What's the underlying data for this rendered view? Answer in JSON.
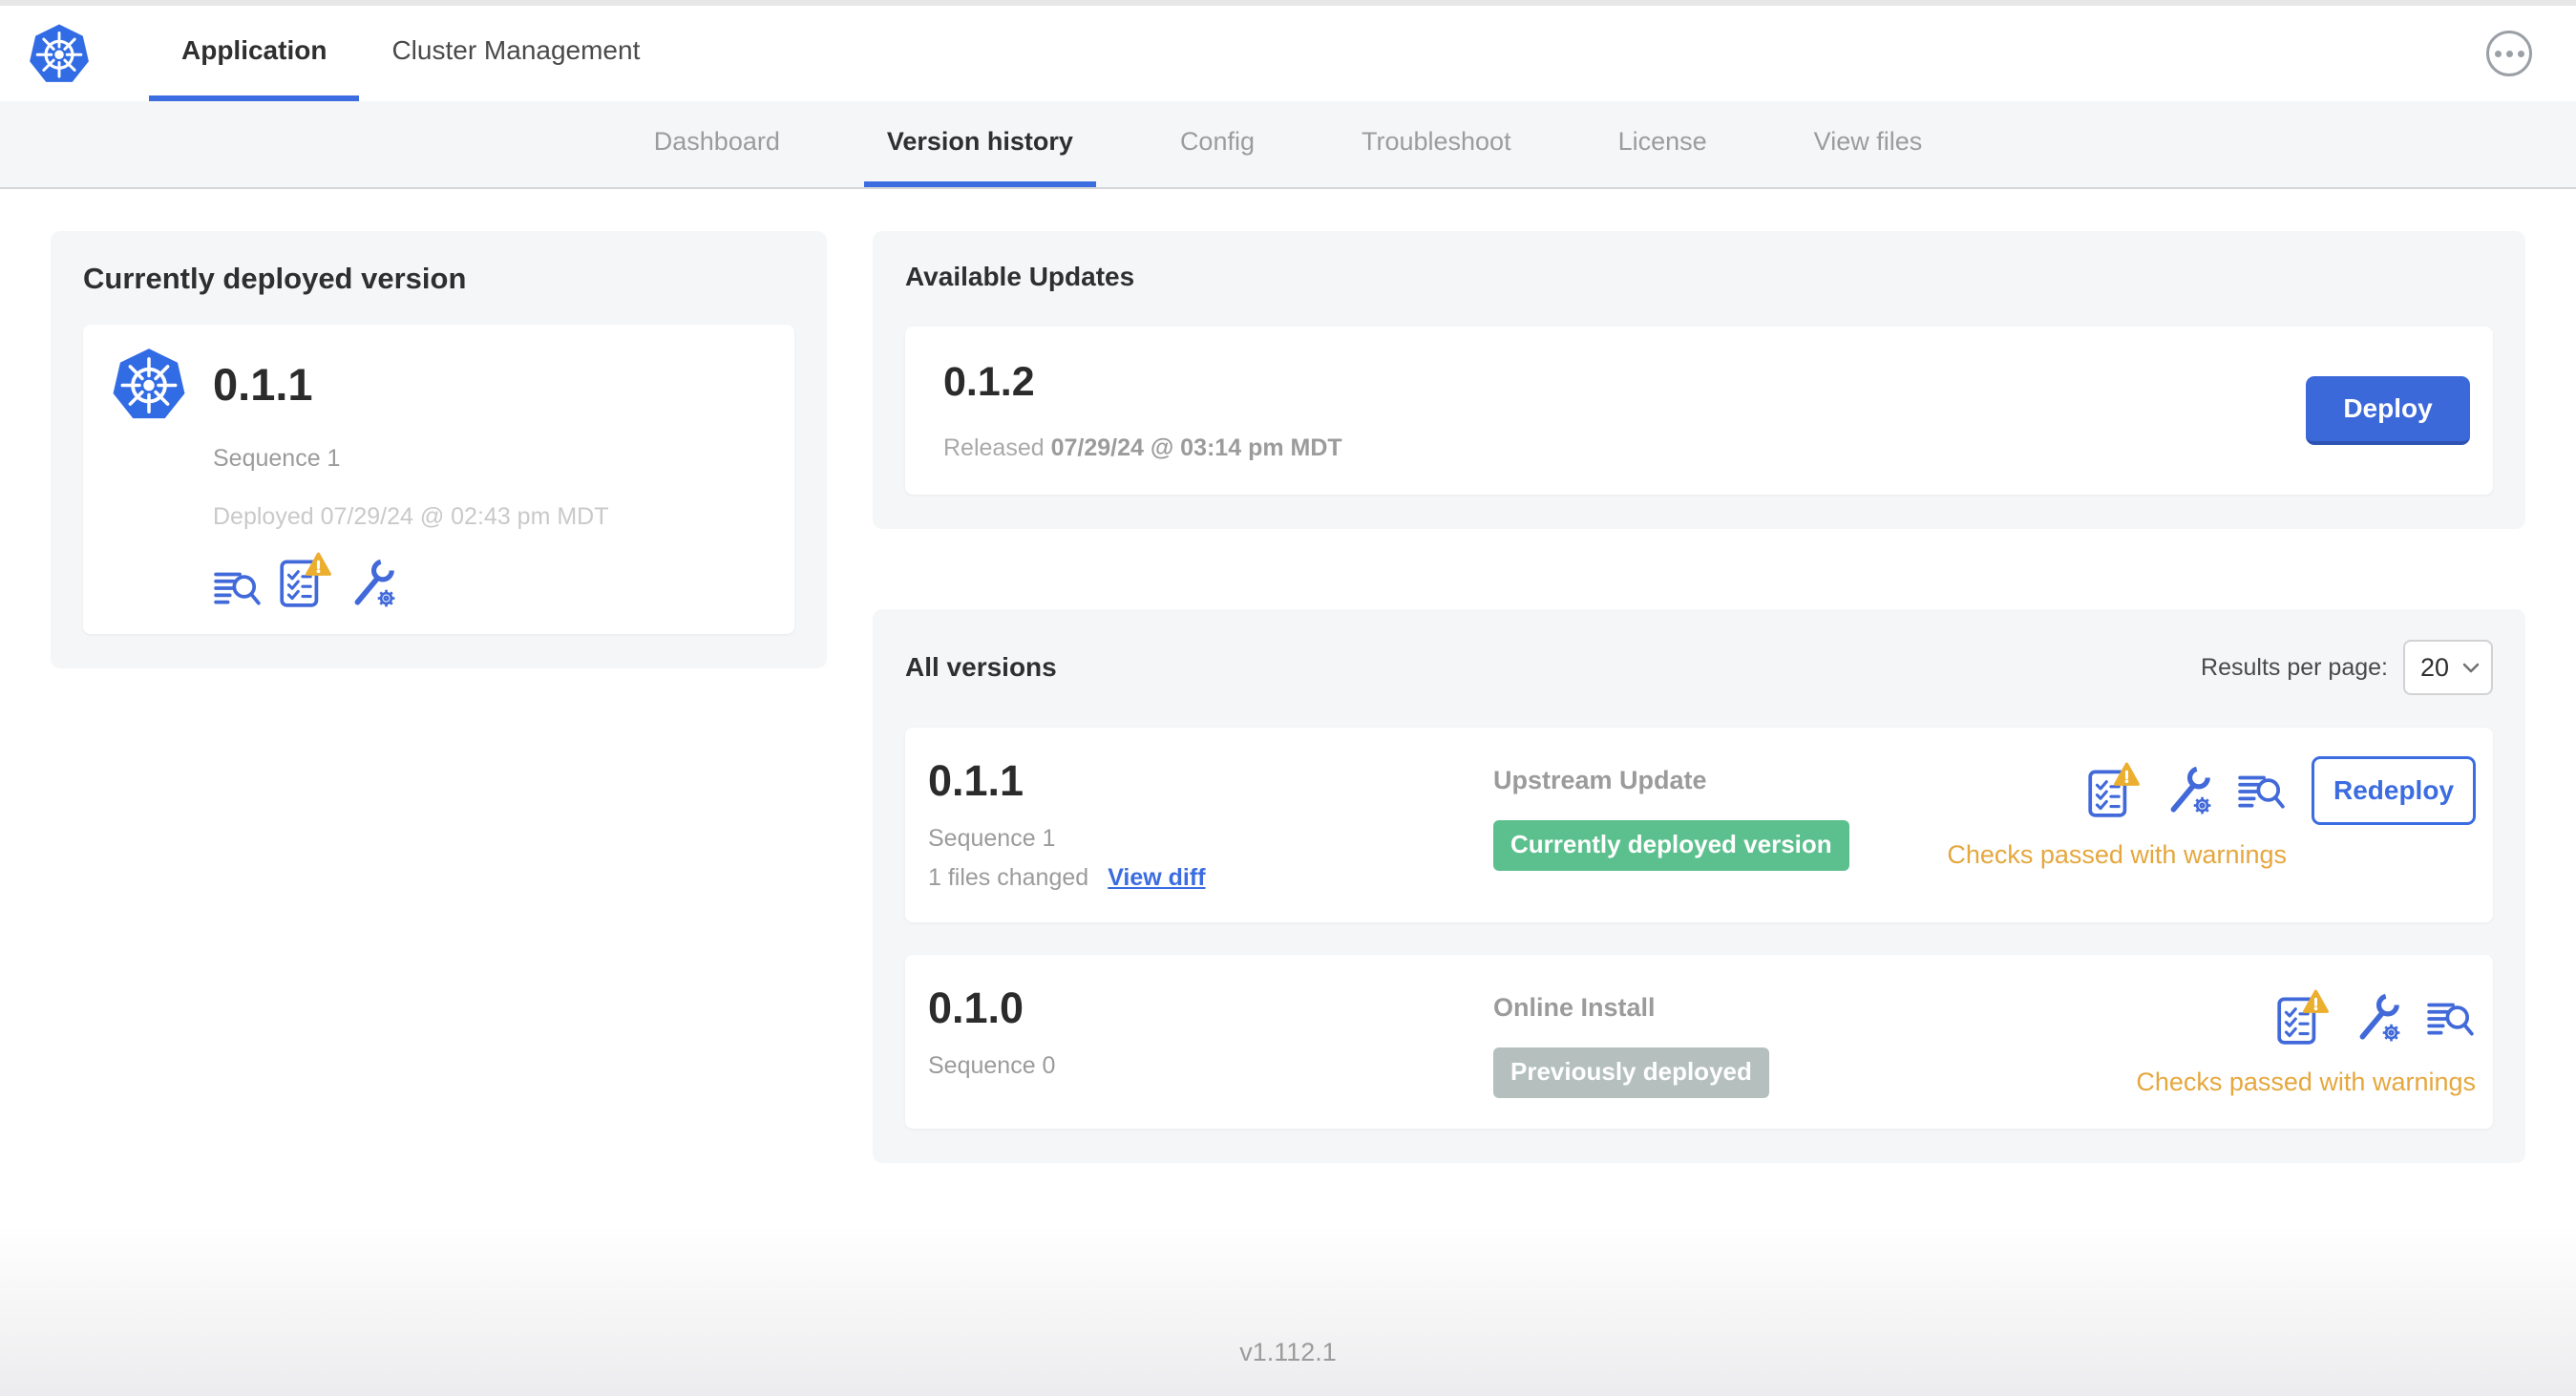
{
  "header": {
    "tabs": [
      {
        "label": "Application",
        "active": true
      },
      {
        "label": "Cluster Management",
        "active": false
      }
    ],
    "menu_icon": "ellipsis-icon"
  },
  "subnav": {
    "tabs": [
      {
        "label": "Dashboard",
        "active": false
      },
      {
        "label": "Version history",
        "active": true
      },
      {
        "label": "Config",
        "active": false
      },
      {
        "label": "Troubleshoot",
        "active": false
      },
      {
        "label": "License",
        "active": false
      },
      {
        "label": "View files",
        "active": false
      }
    ]
  },
  "deployed_card": {
    "title": "Currently deployed version",
    "version": "0.1.1",
    "sequence": "Sequence 1",
    "deployed_at": "Deployed 07/29/24 @ 02:43 pm MDT",
    "icons": [
      "logs-icon",
      "preflight-checks-icon",
      "config-icon"
    ]
  },
  "available_updates": {
    "title": "Available Updates",
    "version": "0.1.2",
    "released_prefix": "Released",
    "released_date": "07/29/24 @ 03:14 pm MDT",
    "deploy_label": "Deploy"
  },
  "all_versions": {
    "title": "All versions",
    "results_per_page_label": "Results per page:",
    "results_per_page_value": "20",
    "rows": [
      {
        "version": "0.1.1",
        "sequence": "Sequence 1",
        "files_changed": "1 files changed",
        "view_diff_label": "View diff",
        "source": "Upstream Update",
        "badge": "Currently deployed version",
        "badge_color": "#5cc08e",
        "icons": [
          "preflight-checks-icon",
          "config-icon",
          "logs-icon"
        ],
        "action_label": "Redeploy",
        "checks_text": "Checks passed with warnings"
      },
      {
        "version": "0.1.0",
        "sequence": "Sequence 0",
        "source": "Online Install",
        "badge": "Previously deployed",
        "badge_color": "#b4bfbe",
        "icons": [
          "preflight-checks-icon",
          "config-icon",
          "logs-icon"
        ],
        "checks_text": "Checks passed with warnings"
      }
    ]
  },
  "footer": {
    "version": "v1.112.1"
  },
  "colors": {
    "accent_blue": "#3b6ce0",
    "kubernetes_blue": "#326ce5",
    "icon_blue": "#4169d9",
    "deploy_button_blue": "#3c69da",
    "badge_green": "#5cc08e",
    "badge_gray": "#b4bfbe",
    "warning_amber": "#ecae2e",
    "checks_warning_text": "#e5a73e",
    "muted_gray": "#9b9b9b",
    "panel_gray": "#f4f6f8"
  }
}
